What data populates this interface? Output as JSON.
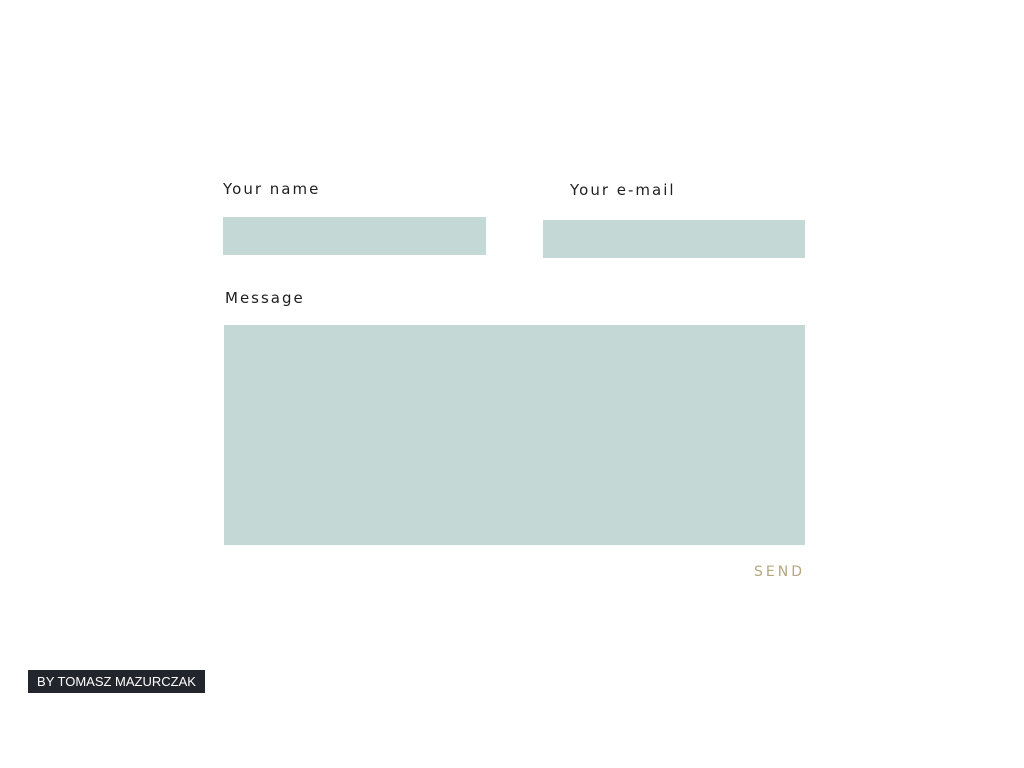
{
  "form": {
    "name_label": "Your name",
    "name_value": "",
    "email_label": "Your e-mail",
    "email_value": "",
    "message_label": "Message",
    "message_value": "",
    "send_label": "SEND"
  },
  "footer": {
    "credit": "BY TOMASZ MAZURCZAK"
  },
  "colors": {
    "field_background": "#c4d8d6",
    "send_text": "#b5a77d",
    "credit_background": "#23252c"
  }
}
